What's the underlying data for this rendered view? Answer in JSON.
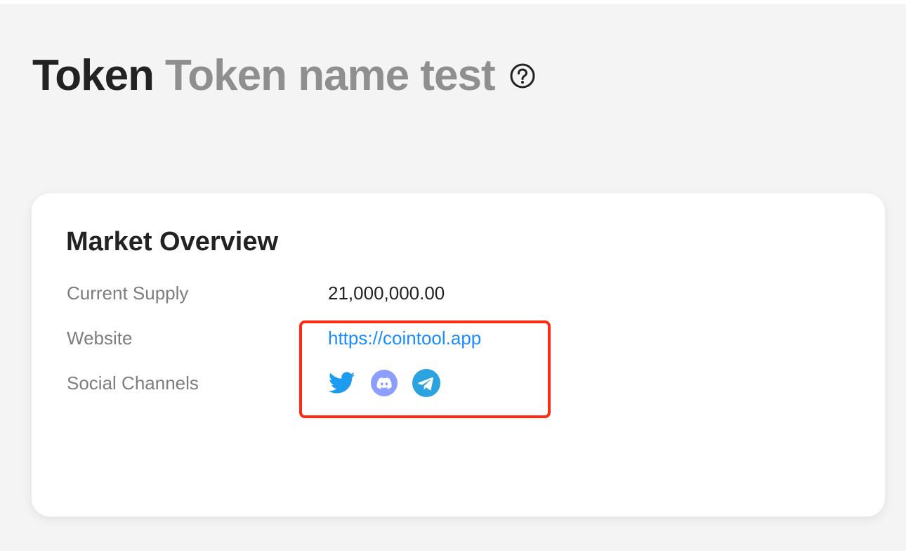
{
  "header": {
    "title": "Token",
    "subtitle": "Token name test",
    "help_icon": "question-circle-icon"
  },
  "market_overview": {
    "title": "Market Overview",
    "rows": [
      {
        "label": "Current Supply",
        "value": "21,000,000.00"
      },
      {
        "label": "Website",
        "value": "https://cointool.app"
      },
      {
        "label": "Social Channels"
      }
    ],
    "social_channels": [
      {
        "name": "twitter-icon",
        "color": "#1d9bf0"
      },
      {
        "name": "discord-icon",
        "color": "#8c9eff"
      },
      {
        "name": "telegram-icon",
        "color": "#2aa3e0"
      }
    ]
  },
  "colors": {
    "background": "#f4f4f4",
    "card": "#ffffff",
    "link": "#1a8cff",
    "highlight": "#ff2a12",
    "subtitle": "#8f8f8f"
  }
}
